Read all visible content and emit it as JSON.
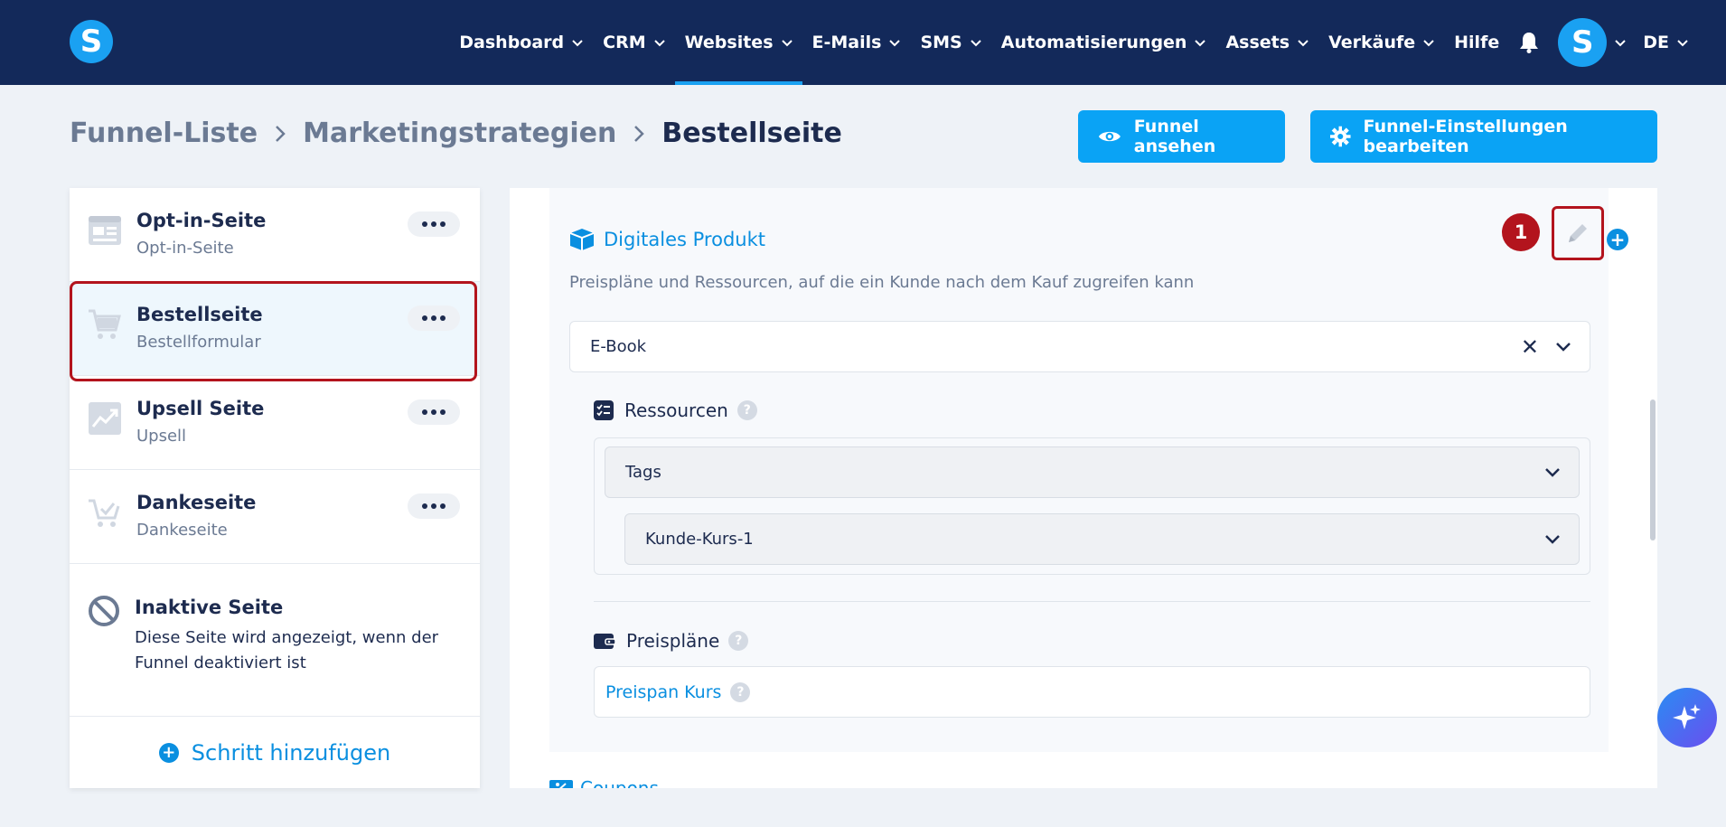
{
  "nav": {
    "logo": "S",
    "items": [
      {
        "label": "Dashboard",
        "dropdown": true
      },
      {
        "label": "CRM",
        "dropdown": true
      },
      {
        "label": "Websites",
        "dropdown": true,
        "active": true
      },
      {
        "label": "E-Mails",
        "dropdown": true
      },
      {
        "label": "SMS",
        "dropdown": true
      },
      {
        "label": "Automatisierungen",
        "dropdown": true
      },
      {
        "label": "Assets",
        "dropdown": true
      },
      {
        "label": "Verkäufe",
        "dropdown": true
      },
      {
        "label": "Hilfe",
        "dropdown": false
      }
    ],
    "avatar": "S",
    "language": "DE"
  },
  "breadcrumb": {
    "items": [
      "Funnel-Liste",
      "Marketingstrategien",
      "Bestellseite"
    ]
  },
  "actions": {
    "view_funnel": "Funnel ansehen",
    "edit_settings": "Funnel-Einstellungen bearbeiten"
  },
  "steps": [
    {
      "title": "Opt-in-Seite",
      "subtitle": "Opt-in-Seite",
      "icon": "page-form-icon"
    },
    {
      "title": "Bestellseite",
      "subtitle": "Bestellformular",
      "icon": "cart-icon",
      "selected": true
    },
    {
      "title": "Upsell Seite",
      "subtitle": "Upsell",
      "icon": "chart-up-icon"
    },
    {
      "title": "Dankeseite",
      "subtitle": "Dankeseite",
      "icon": "cart-check-icon"
    }
  ],
  "inactive": {
    "title": "Inaktive Seite",
    "description": "Diese Seite wird angezeigt, wenn der Funnel deaktiviert ist"
  },
  "add_step": "Schritt hinzufügen",
  "product": {
    "title": "Digitales Produkt",
    "description": "Preispläne und Ressourcen, auf die ein Kunde nach dem Kauf zugreifen kann",
    "marker": "1",
    "selected_product": "E-Book",
    "resources_label": "Ressourcen",
    "resource_type": "Tags",
    "resource_value": "Kunde-Kurs-1",
    "plans_label": "Preispläne",
    "plan_name": "Preispan Kurs",
    "help": "?"
  },
  "coupons_label": "Coupons",
  "colors": {
    "nav_bg": "#13295a",
    "accent": "#0aa3f5",
    "link": "#0a8fe0",
    "highlight": "#b3141d"
  }
}
